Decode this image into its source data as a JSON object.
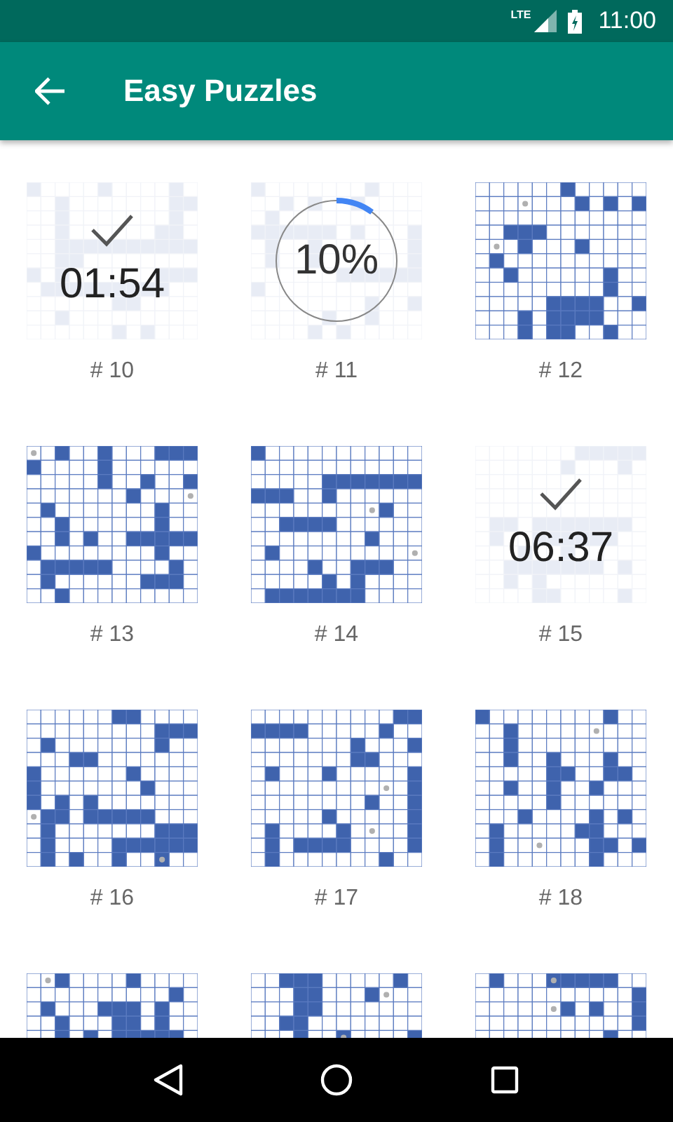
{
  "status_bar": {
    "network": "LTE",
    "time": "11:00"
  },
  "app_bar": {
    "title": "Easy Puzzles"
  },
  "puzzles": [
    {
      "kind": "solved",
      "label": "# 10",
      "time": "01:54"
    },
    {
      "kind": "in_progress",
      "label": "# 11",
      "progress": "10%"
    },
    {
      "kind": "new",
      "label": "# 12"
    },
    {
      "kind": "new",
      "label": "# 13"
    },
    {
      "kind": "new",
      "label": "# 14"
    },
    {
      "kind": "solved",
      "label": "# 15",
      "time": "06:37"
    },
    {
      "kind": "new",
      "label": "# 16"
    },
    {
      "kind": "new",
      "label": "# 17"
    },
    {
      "kind": "new",
      "label": "# 18"
    },
    {
      "kind": "new"
    },
    {
      "kind": "new"
    },
    {
      "kind": "new"
    }
  ]
}
